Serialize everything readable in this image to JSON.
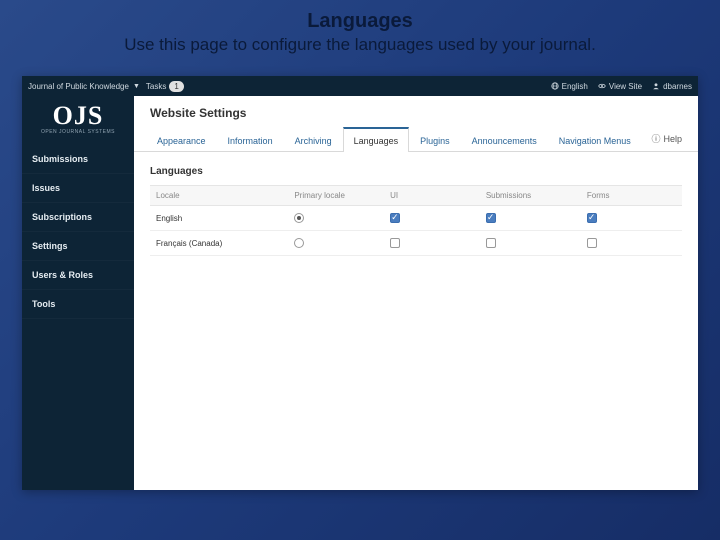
{
  "slide": {
    "title": "Languages",
    "subtitle": "Use this page to configure the languages used by your journal."
  },
  "topbar": {
    "journal_label": "Journal of Public Knowledge",
    "tasks_label": "Tasks",
    "tasks_count": "1",
    "lang_label": "English",
    "view_site_label": "View Site",
    "user_label": "dbarnes"
  },
  "logo": {
    "main": "OJS",
    "sub": "OPEN JOURNAL SYSTEMS"
  },
  "sidebar": {
    "items": [
      {
        "label": "Submissions"
      },
      {
        "label": "Issues"
      },
      {
        "label": "Subscriptions"
      },
      {
        "label": "Settings"
      },
      {
        "label": "Users & Roles"
      },
      {
        "label": "Tools"
      }
    ]
  },
  "page": {
    "title": "Website Settings",
    "tabs": [
      {
        "label": "Appearance"
      },
      {
        "label": "Information"
      },
      {
        "label": "Archiving"
      },
      {
        "label": "Languages"
      },
      {
        "label": "Plugins"
      },
      {
        "label": "Announcements"
      },
      {
        "label": "Navigation Menus"
      }
    ],
    "active_tab_index": 3,
    "help_label": "Help"
  },
  "languages": {
    "panel_title": "Languages",
    "columns": {
      "locale": "Locale",
      "primary": "Primary locale",
      "ui": "UI",
      "submissions": "Submissions",
      "forms": "Forms"
    },
    "rows": [
      {
        "locale": "English",
        "primary": true,
        "ui": true,
        "submissions": true,
        "forms": true
      },
      {
        "locale": "Français (Canada)",
        "primary": false,
        "ui": false,
        "submissions": false,
        "forms": false
      }
    ]
  }
}
